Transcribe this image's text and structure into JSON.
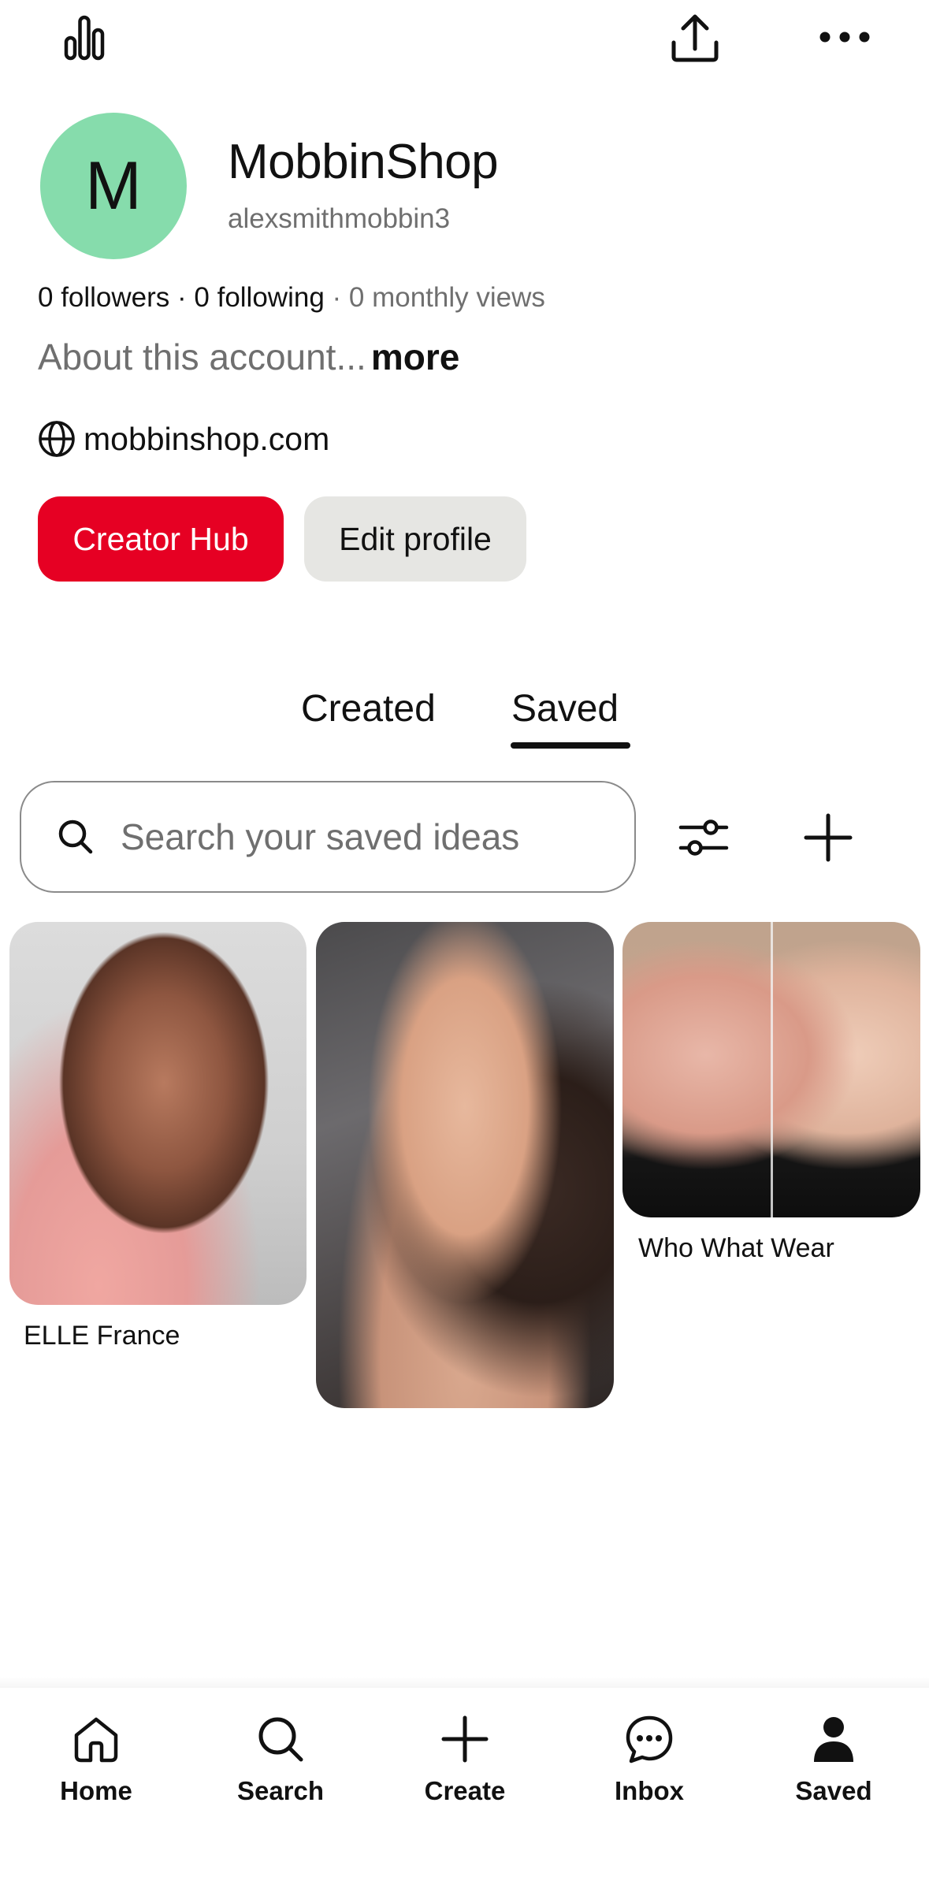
{
  "topbar": {
    "icons": [
      "stats-icon",
      "share-icon",
      "more-icon"
    ]
  },
  "profile": {
    "avatar_letter": "M",
    "avatar_color": "#86dcac",
    "name": "MobbinShop",
    "handle": "alexsmithmobbin3",
    "followers": "0 followers",
    "following": "0 following",
    "separator": " · ",
    "monthly_views": "0 monthly views",
    "about": "About this account...",
    "about_more": "more",
    "website": "mobbinshop.com"
  },
  "actions": {
    "creator_hub": "Creator Hub",
    "edit_profile": "Edit profile",
    "creator_hub_color": "#e60023"
  },
  "tabs": {
    "created": "Created",
    "saved": "Saved",
    "active": "Saved"
  },
  "search": {
    "placeholder": "Search your saved ideas",
    "value": ""
  },
  "pins": [
    {
      "caption": "ELLE France"
    },
    {
      "caption": ""
    },
    {
      "caption": "Who What Wear"
    }
  ],
  "nav": {
    "home": "Home",
    "search": "Search",
    "create": "Create",
    "inbox": "Inbox",
    "saved": "Saved"
  }
}
